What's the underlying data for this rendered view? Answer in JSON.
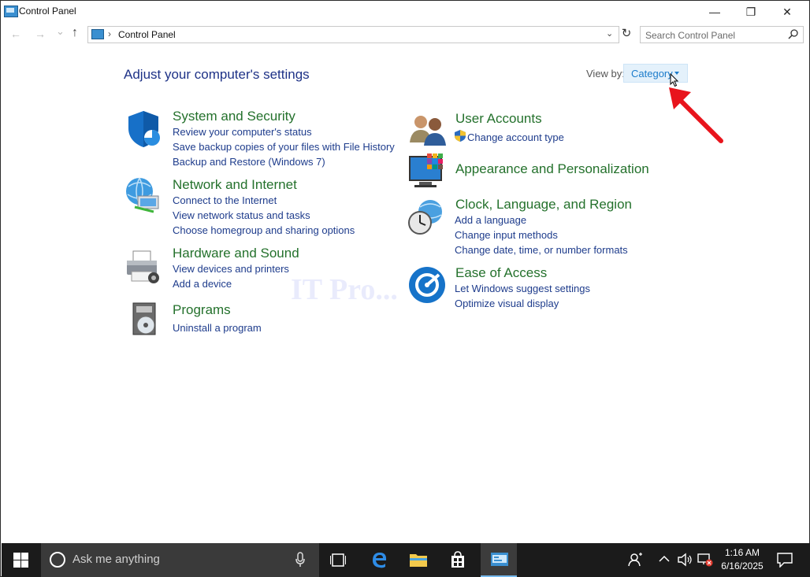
{
  "window": {
    "title": "Control Panel",
    "minimize_glyph": "—",
    "restore_glyph": "❐",
    "close_glyph": "✕"
  },
  "address": {
    "back_glyph": "←",
    "forward_glyph": "→",
    "dropdown_glyph": "⌄",
    "up_glyph": "↑",
    "path": "Control Panel",
    "separator": "›",
    "refresh_glyph": "↻",
    "search_placeholder": "Search Control Panel"
  },
  "main": {
    "heading": "Adjust your computer's settings",
    "view_by_label": "View by:",
    "view_by_value": "Category"
  },
  "categories": [
    {
      "title": "System and Security",
      "icon": "shield-icon",
      "links": [
        "Review your computer's status",
        "Save backup copies of your files with File History",
        "Backup and Restore (Windows 7)"
      ]
    },
    {
      "title": "Network and Internet",
      "icon": "network-globe-icon",
      "links": [
        "Connect to the Internet",
        "View network status and tasks",
        "Choose homegroup and sharing options"
      ]
    },
    {
      "title": "Hardware and Sound",
      "icon": "printer-icon",
      "links": [
        "View devices and printers",
        "Add a device"
      ]
    },
    {
      "title": "Programs",
      "icon": "programs-disc-icon",
      "links": [
        "Uninstall a program"
      ]
    },
    {
      "title": "User Accounts",
      "icon": "users-icon",
      "links": [
        "Change account type"
      ]
    },
    {
      "title": "Appearance and Personalization",
      "icon": "monitor-palette-icon",
      "links": []
    },
    {
      "title": "Clock, Language, and Region",
      "icon": "clock-globe-icon",
      "links": [
        "Add a language",
        "Change input methods",
        "Change date, time, or number formats"
      ]
    },
    {
      "title": "Ease of Access",
      "icon": "ease-of-access-icon",
      "links": [
        "Let Windows suggest settings",
        "Optimize visual display"
      ]
    }
  ],
  "watermark": "IT Pro...",
  "taskbar": {
    "search_text": "Ask me anything",
    "apps": [
      "task-view-icon",
      "edge-icon",
      "file-explorer-icon",
      "store-icon",
      "control-panel-icon"
    ],
    "time": "1:16 AM",
    "date": "6/16/2025"
  },
  "colors": {
    "category_title": "#24712c",
    "link": "#1e3c8c",
    "heading": "#1e3287",
    "accent": "#1c7ccb",
    "annotation_arrow": "#e8141c",
    "taskbar": "#1b1b1b"
  }
}
